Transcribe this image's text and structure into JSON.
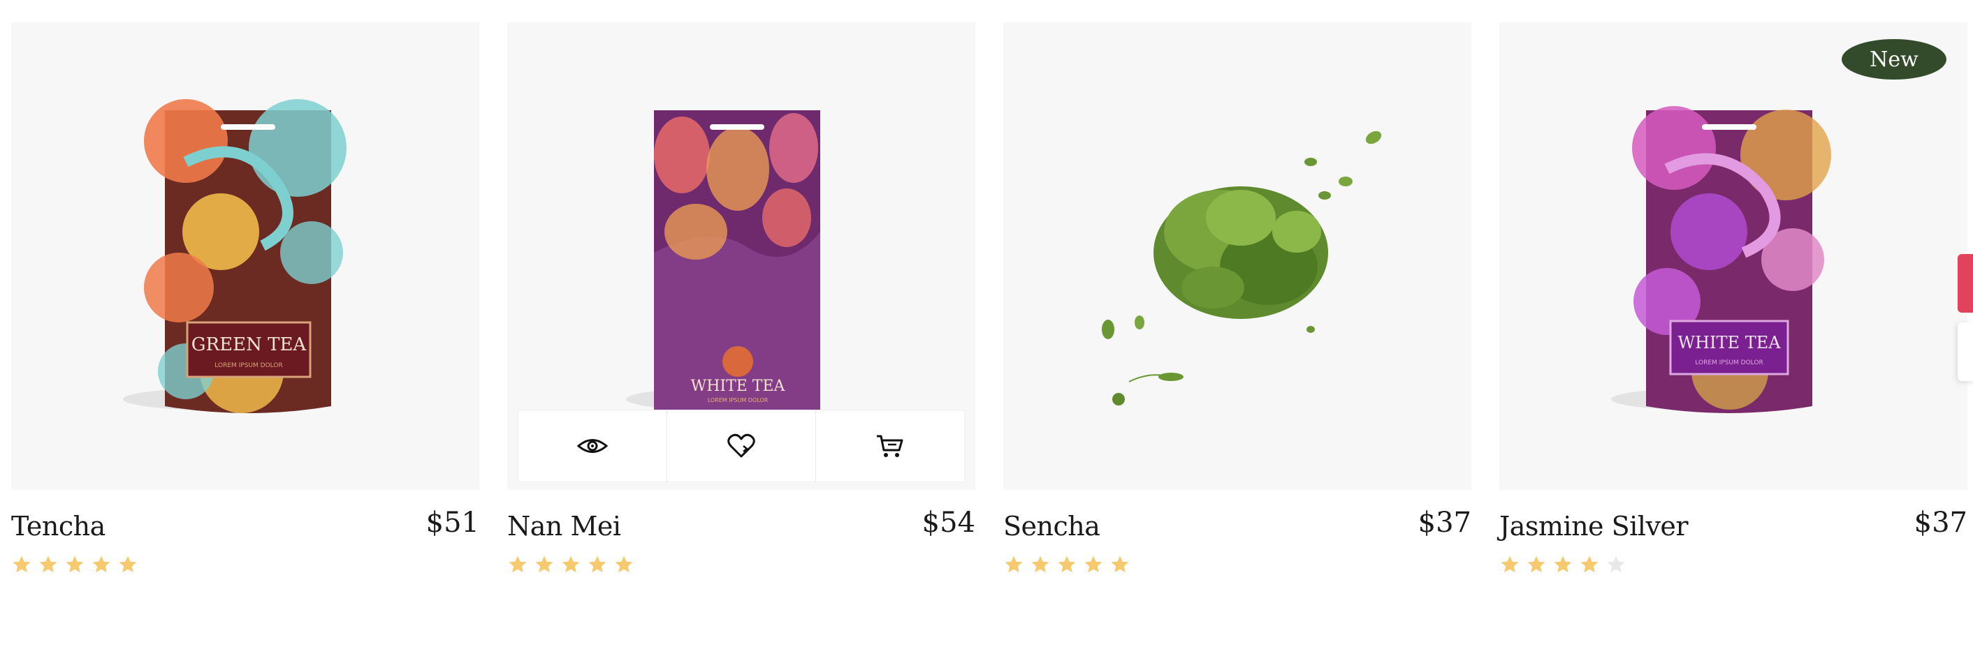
{
  "products": [
    {
      "name": "Tencha",
      "price": "$51",
      "rating": 5,
      "package_label": "GREEN TEA",
      "package_sublabel": "LOREM IPSUM DOLOR",
      "badge": ""
    },
    {
      "name": "Nan Mei",
      "price": "$54",
      "rating": 5,
      "package_label": "WHITE TEA",
      "package_sublabel": "LOREM IPSUM DOLOR",
      "badge": ""
    },
    {
      "name": "Sencha",
      "price": "$37",
      "rating": 5,
      "package_label": "",
      "package_sublabel": "",
      "badge": ""
    },
    {
      "name": "Jasmine Silver",
      "price": "$37",
      "rating": 4,
      "package_label": "WHITE TEA",
      "package_sublabel": "LOREM IPSUM DOLOR",
      "badge": "New"
    }
  ],
  "quick_actions": {
    "icons": [
      "eye-icon",
      "heart-icon",
      "cart-icon"
    ]
  },
  "colors": {
    "star_filled": "#f6c96e",
    "star_empty": "#e8e8e8",
    "badge_bg": "#344b2b",
    "thumb_bg": "#f7f7f7",
    "side_tab": "#e0435b"
  }
}
